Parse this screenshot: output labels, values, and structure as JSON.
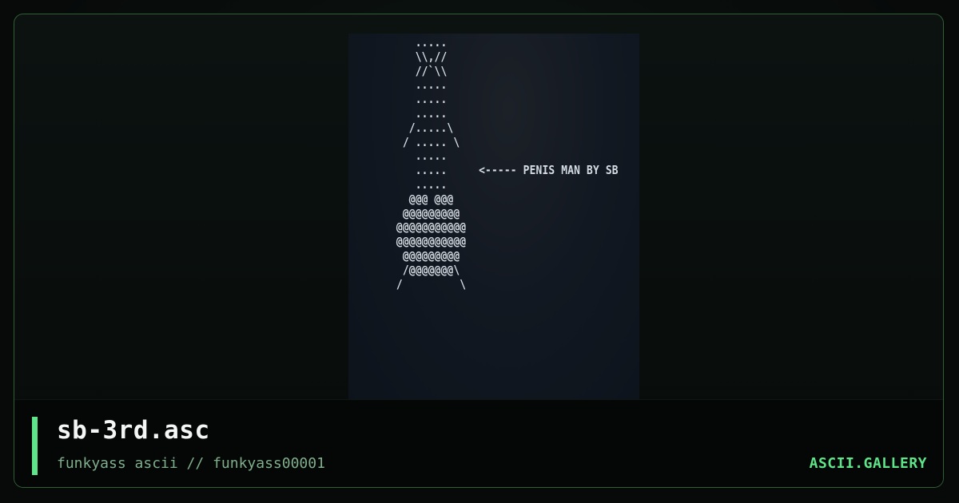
{
  "art": {
    "lines": [
      "     .....",
      "     \\\\,//",
      "     //`\\\\",
      "     .....",
      "     .....",
      "     .....",
      "    /.....\\",
      "   / ..... \\",
      "     .....",
      "     .....     <----- PENIS MAN BY SB",
      "     .....",
      "    @@@ @@@",
      "   @@@@@@@@@",
      "  @@@@@@@@@@@",
      "  @@@@@@@@@@@",
      "   @@@@@@@@@",
      "   /@@@@@@@\\",
      "  /         \\"
    ]
  },
  "file": {
    "title": "sb-3rd.asc",
    "subtitle": "funkyass ascii // funkyass00001"
  },
  "brand": {
    "label": "ASCII.GALLERY"
  },
  "colors": {
    "accent": "#5ee58a",
    "subtitle": "#7fae8c",
    "frame_border": "#2e5f35",
    "art_text": "#d7dde4"
  }
}
